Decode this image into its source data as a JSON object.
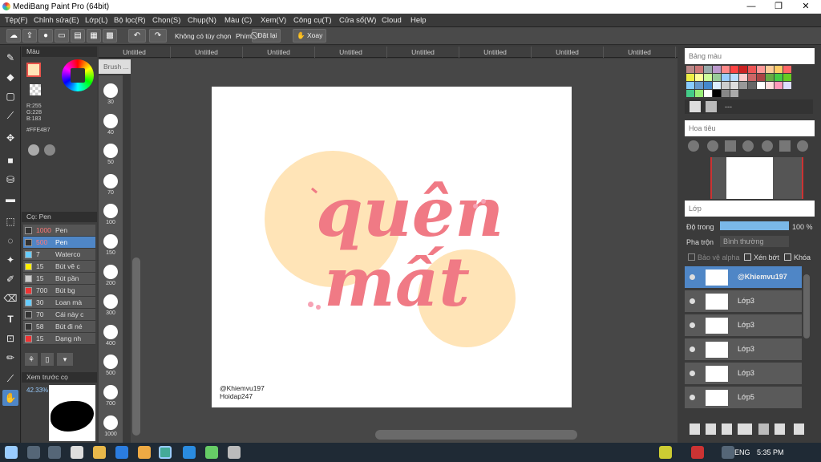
{
  "window": {
    "title": "MediBang Paint Pro (64bit)",
    "min": "—",
    "max": "❐",
    "close": "✕"
  },
  "menu": [
    "Tệp(F)",
    "Chỉnh sửa(E)",
    "Lớp(L)",
    "Bộ lọc(R)",
    "Chọn(S)",
    "Chụp(N)",
    "Màu (C)",
    "Xem(V)",
    "Công cụ(T)",
    "Cửa sổ(W)",
    "Cloud",
    "Help"
  ],
  "toolbar": {
    "no_option": "Không có tùy chọn",
    "key_label": "Phím",
    "reset": "Đặt lại",
    "rotate": "Xoay"
  },
  "tabs": [
    "Untitled",
    "Untitled",
    "Untitled",
    "Untitled",
    "Untitled",
    "Untitled",
    "Untitled",
    "Untitled"
  ],
  "color_panel": {
    "title": "Màu",
    "r": "R:255",
    "g": "G:228",
    "b": "B:183",
    "hex": "#FFE4B7",
    "fg": "#FFE4B7",
    "accent": "#e8524a"
  },
  "brush_panel": {
    "title": "Cọ: Pen",
    "items": [
      {
        "size": "1000",
        "name": "Pen",
        "color": "#333333"
      },
      {
        "size": "500",
        "name": "Pen",
        "color": "#333333"
      },
      {
        "size": "7",
        "name": "Waterco",
        "color": "#66ccff"
      },
      {
        "size": "15",
        "name": "Bút vẽ c",
        "color": "#ffee00"
      },
      {
        "size": "15",
        "name": "Bút pần",
        "color": "#cccccc"
      },
      {
        "size": "700",
        "name": "Bút bg",
        "color": "#ee3333"
      },
      {
        "size": "30",
        "name": "Loan mà",
        "color": "#66ccff"
      },
      {
        "size": "70",
        "name": "Cái này c",
        "color": "#333333"
      },
      {
        "size": "58",
        "name": "Bút đi né",
        "color": "#333333"
      },
      {
        "size": "15",
        "name": "Dạng nh",
        "color": "#ee3333"
      }
    ]
  },
  "preview": {
    "title": "Xem trước cọ",
    "zoom": "42.33%"
  },
  "sizes": {
    "header": "Brush ...",
    "values": [
      "30",
      "40",
      "50",
      "70",
      "100",
      "150",
      "200",
      "300",
      "400",
      "500",
      "700",
      "1000"
    ]
  },
  "canvas": {
    "line1": "quên",
    "line2": "mất",
    "credit1": "@Khiemvu197",
    "credit2": "Hoidap247",
    "circle_color": "#FFE4B7",
    "text_color": "#f07a85"
  },
  "palette_panel": {
    "title": "Bảng màu",
    "name": "---"
  },
  "navigator": {
    "title": "Hoa tiêu"
  },
  "layers_panel": {
    "title": "Lớp",
    "opacity_label": "Độ trong",
    "opacity_value": "100 %",
    "blend_label": "Pha trộn",
    "blend_value": "Bình thường",
    "protect_alpha": "Bảo vệ alpha",
    "clipping": "Xén bớt",
    "lock": "Khóa",
    "layers": [
      "@Khiemvu197",
      "Lớp3",
      "Lớp3",
      "Lớp3",
      "Lớp3",
      "Lớp5"
    ]
  },
  "taskbar": {
    "lang": "ENG",
    "time": "5:35 PM"
  }
}
